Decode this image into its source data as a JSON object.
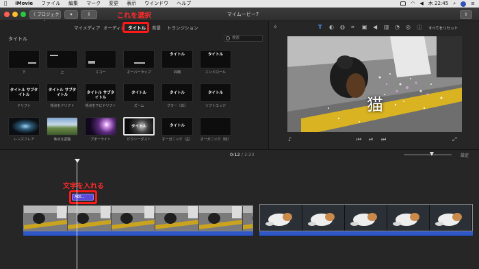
{
  "menubar": {
    "apple": "",
    "app": "iMovie",
    "items": [
      "ファイル",
      "編集",
      "マーク",
      "変更",
      "表示",
      "ウインドウ",
      "ヘルプ"
    ],
    "clock": "木 22:45"
  },
  "toolbar": {
    "projects_label": "〈 プロジェクト",
    "window_title": "マイムービー7"
  },
  "browser": {
    "tabs": [
      "マイメディア",
      "オーディオ",
      "タイトル",
      "背景",
      "トランジション"
    ],
    "active_tab": "タイトル",
    "section_label": "タイトル",
    "search_placeholder": "検索",
    "titles": [
      {
        "label": "下",
        "text": ""
      },
      {
        "label": "上",
        "text": ""
      },
      {
        "label": "エコー",
        "text": ""
      },
      {
        "label": "オーバーラップ",
        "text": ""
      },
      {
        "label": "四隅",
        "text": "タイトル"
      },
      {
        "label": "エンドロール",
        "text": "タイトル"
      },
      {
        "label": "ドリフト",
        "text": "タイトル サブタイトル"
      },
      {
        "label": "視点をドリフト",
        "text": "タイトル サブタイトル"
      },
      {
        "label": "視点を下にドリフト",
        "text": "タイトル サブタイトル"
      },
      {
        "label": "ズーム",
        "text": "タイトル"
      },
      {
        "label": "ブラー（白）",
        "text": "タイトル"
      },
      {
        "label": "ソフトエッジ",
        "text": "タイトル"
      },
      {
        "label": "レンズフレア",
        "text": ""
      },
      {
        "label": "焦点を調整",
        "text": ""
      },
      {
        "label": "プポーライト",
        "text": ""
      },
      {
        "label": "ピクシーダスト",
        "text": "タイトル"
      },
      {
        "label": "オーガニック（主）",
        "text": "タイトル"
      },
      {
        "label": "オーガニック（枚）",
        "text": ""
      }
    ]
  },
  "viewer": {
    "reset_label": "すべてをリセット",
    "overlay_text": "猫"
  },
  "timeline": {
    "current_time": "0:12",
    "total_time": "2:23",
    "settings_label": "設定",
    "title_clip_label": "AE6...",
    "annotations": {
      "select_note": "これを選択",
      "insert_note": "文字を入れる"
    }
  },
  "colors": {
    "annotation_red": "#ff1a1a",
    "audio_bar_blue": "#2f57c8",
    "title_clip_purple": "#5b4bd6"
  }
}
